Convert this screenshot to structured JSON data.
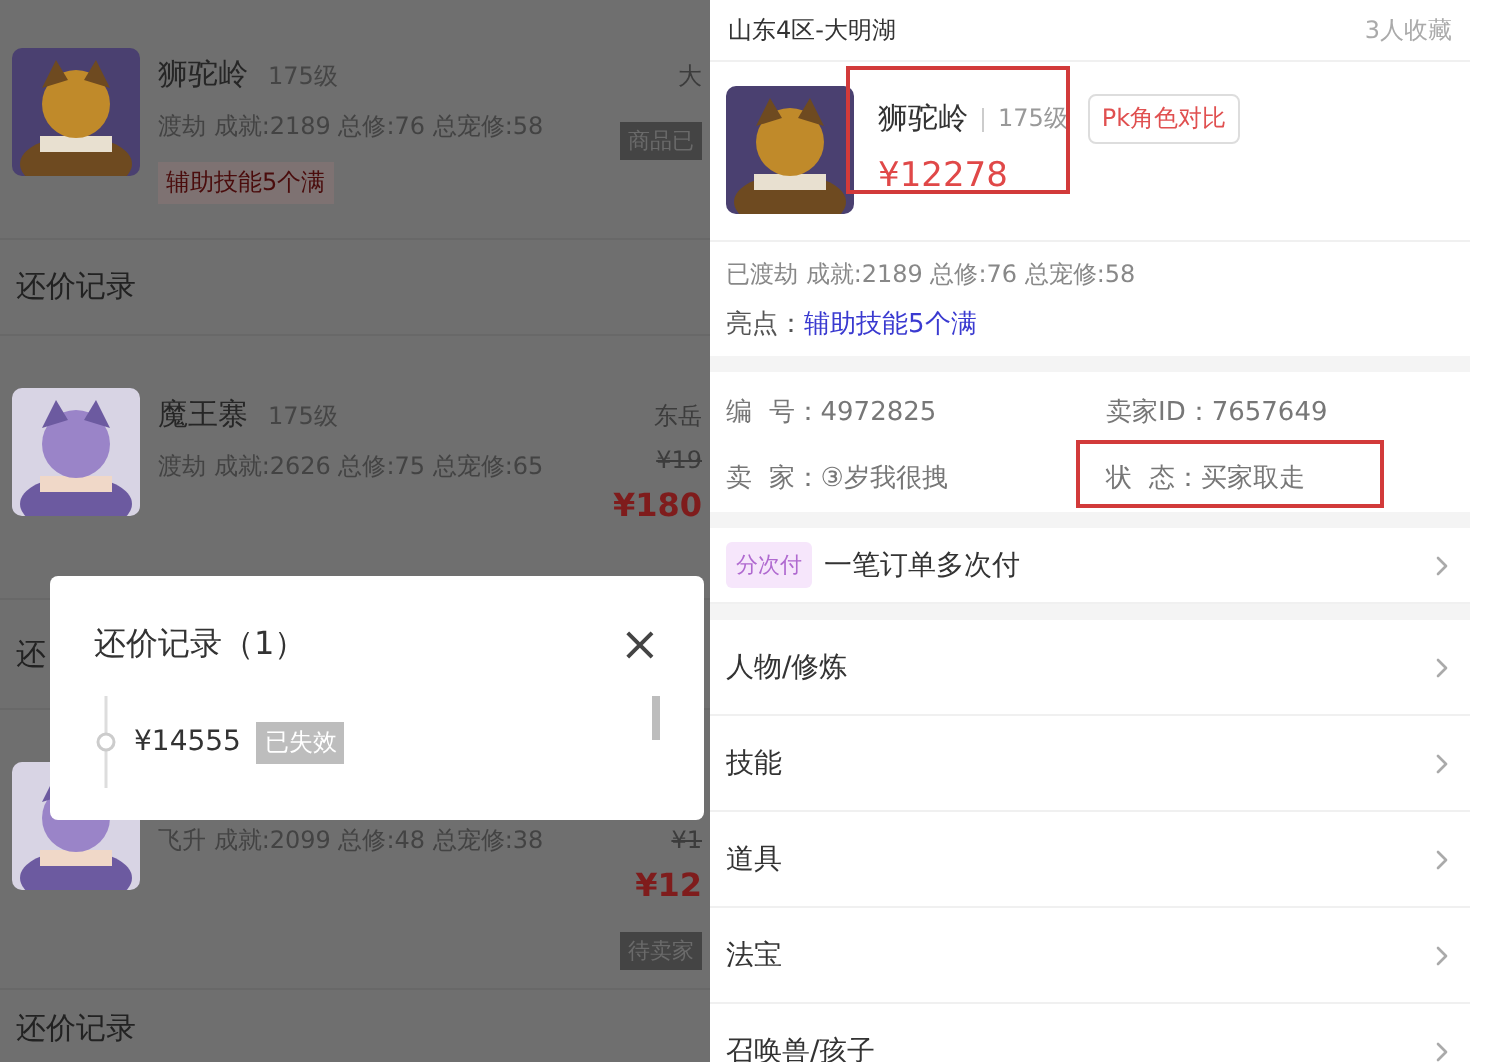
{
  "background_list": [
    {
      "kind": "listing",
      "name": "狮驼岭",
      "grade": "175级",
      "stats": "渡劫 成就:2189 总修:76 总宠修:58",
      "highlight": "辅助技能5个满",
      "server": "大",
      "status_badge": "商品已"
    },
    {
      "kind": "heading",
      "text": "还价记录"
    },
    {
      "kind": "listing",
      "name": "魔王寨",
      "grade": "175级",
      "stats": "渡劫 成就:2626 总修:75 总宠修:65",
      "server": "东岳",
      "original_price": "¥19",
      "price": "¥180"
    },
    {
      "kind": "heading",
      "text": "还"
    },
    {
      "kind": "listing",
      "stats": "飞升 成就:2099 总修:48 总宠修:38",
      "original_price": "¥1",
      "price": "¥12",
      "status_badge": "待卖家"
    },
    {
      "kind": "heading",
      "text": "还价记录"
    }
  ],
  "counter_offer_dialog": {
    "title": "还价记录（1）",
    "close": "×",
    "offers": [
      {
        "price": "¥14555",
        "status": "已失效"
      }
    ]
  },
  "detail": {
    "server": "山东4区-大明湖",
    "favorites": "3人收藏",
    "name": "狮驼岭",
    "grade": "175级",
    "compare_button": "Pk角色对比",
    "price": "¥12278",
    "stats": "已渡劫 成就:2189 总修:76 总宠修:58",
    "highlight_label": "亮点：",
    "highlight": "辅助技能5个满",
    "info": [
      {
        "text": "编  号：4972825",
        "annotated": false
      },
      {
        "text": "卖家ID：7657649",
        "annotated": false
      },
      {
        "text": "卖  家：③岁我很拽",
        "annotated": false
      },
      {
        "text": "状  态：买家取走",
        "annotated": true
      }
    ],
    "menu": [
      {
        "kind": "payment",
        "tag": "分次付",
        "label": "一笔订单多次付"
      },
      {
        "kind": "link",
        "label": "人物/修炼"
      },
      {
        "kind": "link",
        "label": "技能"
      },
      {
        "kind": "link",
        "label": "道具"
      },
      {
        "kind": "link",
        "label": "法宝"
      },
      {
        "kind": "link",
        "label": "召唤兽/孩子"
      }
    ]
  }
}
